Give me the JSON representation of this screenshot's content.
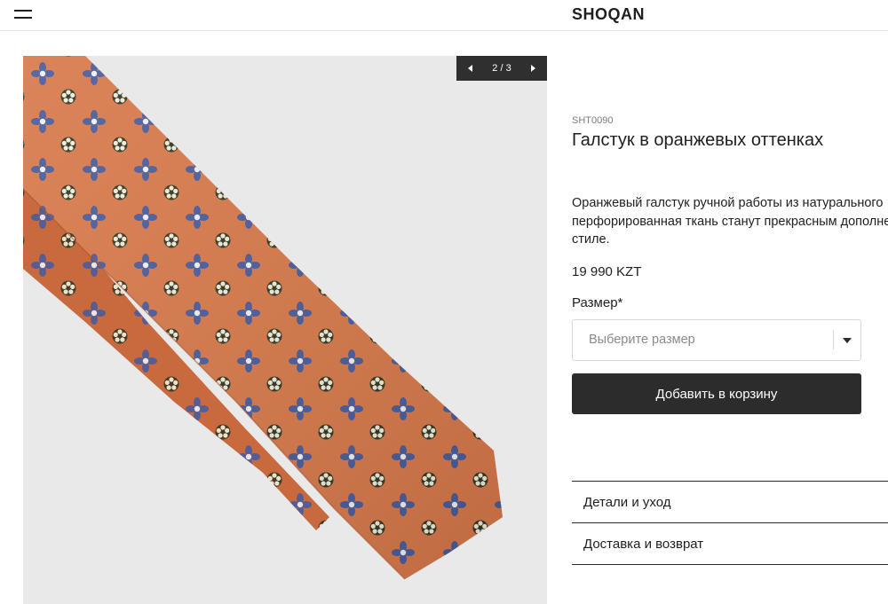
{
  "header": {
    "logo": "SHOQAN",
    "menu_icon": "hamburger-menu-icon"
  },
  "gallery": {
    "counter": "2 / 3",
    "prev_icon": "arrow-left-icon",
    "next_icon": "arrow-right-icon",
    "tie_color": "#d9794a"
  },
  "product": {
    "sku": "SHT0090",
    "title": "Галстук в оранжевых оттенках",
    "description_lines": [
      "Оранжевый галстук ручной работы из натурального",
      "перфорированная ткань станут прекрасным дополне",
      "стиле."
    ],
    "price": "19 990 KZT",
    "size_label": "Размер*",
    "size_placeholder": "Выберите размер",
    "add_to_cart": "Добавить в корзину"
  },
  "accordion": [
    {
      "label": "Детали и уход"
    },
    {
      "label": "Доставка и возврат"
    }
  ]
}
